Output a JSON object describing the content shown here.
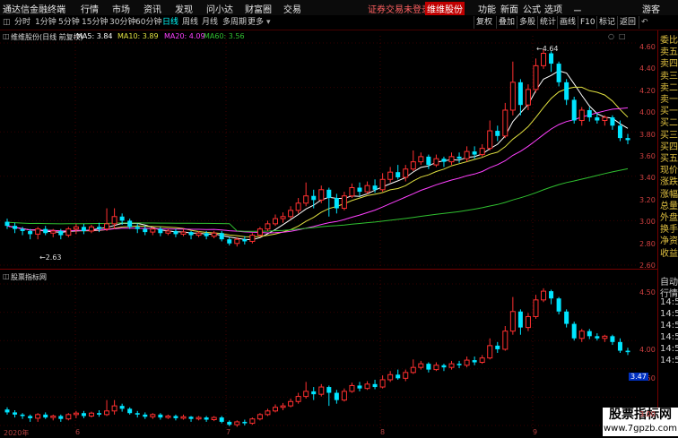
{
  "topbar": {
    "logo": "通达信金融终端",
    "menus": [
      "行情",
      "市场",
      "资讯",
      "发现",
      "问小达",
      "财富圈",
      "交易"
    ],
    "login_status": "证券交易未登录",
    "stock_name_red": "维维股份",
    "right_menus": [
      "功能",
      "新面",
      "公式",
      "选项"
    ],
    "user": "游客"
  },
  "toolbar": {
    "periods": [
      "分时",
      "1分钟",
      "5分钟",
      "15分钟",
      "30分钟",
      "60分钟",
      "日线",
      "周线",
      "月线",
      "多周期",
      "更多"
    ],
    "active_period": "日线",
    "right_buttons": [
      "复权",
      "叠加",
      "多股",
      "统计",
      "画线",
      "F10",
      "标记",
      "返回"
    ]
  },
  "indicator_line": {
    "title": "维维股份(日线 前复权)",
    "ma5": "MA5: 3.84",
    "ma10": "MA10: 3.89",
    "ma20": "MA20: 4.09",
    "ma60": "MA60: 3.56"
  },
  "main_yaxis": [
    "4.60",
    "4.40",
    "4.20",
    "4.00",
    "3.80",
    "3.60",
    "3.40",
    "3.20",
    "3.00",
    "2.80",
    "2.60"
  ],
  "annotations": {
    "high": "4.64",
    "low": "2.63"
  },
  "sub_panel": {
    "title": "股票指标网",
    "yaxis": [
      "4.50",
      "4.00",
      "3.50",
      "3.00"
    ],
    "current": "3.47"
  },
  "xaxis": [
    "2020年",
    "6",
    "7",
    "8",
    "9"
  ],
  "right_panel": {
    "rows": [
      "委比",
      "卖五",
      "卖四",
      "卖三",
      "卖二",
      "卖一",
      "买一",
      "买二",
      "买三",
      "买四",
      "买五",
      "现价",
      "涨跌",
      "涨幅",
      "总量",
      "外盘",
      "换手",
      "净资",
      "收益"
    ],
    "bottom_rows": [
      "自动",
      "行情",
      "14:50",
      "14:50",
      "14:50",
      "14:50",
      "14:50",
      "14:5"
    ]
  },
  "watermark": {
    "line1": "股票指标网",
    "line2": "www.7gpzb.com"
  },
  "colors": {
    "up": "#ff3030",
    "up_hollow": "#ff3030",
    "down": "#00e5ff",
    "ma5": "#ffffff",
    "ma10": "#e0e040",
    "ma20": "#ff40ff",
    "ma60": "#30c030"
  },
  "chart_data": {
    "type": "candlestick",
    "title": "维维股份(日线 前复权)",
    "ylim": [
      2.55,
      4.7
    ],
    "candles": [
      [
        2.97,
        2.93,
        3.0,
        2.9
      ],
      [
        2.93,
        2.9,
        2.96,
        2.86
      ],
      [
        2.9,
        2.88,
        2.92,
        2.84
      ],
      [
        2.88,
        2.85,
        2.9,
        2.8
      ],
      [
        2.85,
        2.9,
        2.92,
        2.8
      ],
      [
        2.9,
        2.86,
        2.93,
        2.84
      ],
      [
        2.86,
        2.88,
        2.9,
        2.82
      ],
      [
        2.88,
        2.84,
        2.9,
        2.8
      ],
      [
        2.84,
        2.9,
        2.92,
        2.82
      ],
      [
        2.9,
        2.92,
        2.95,
        2.85
      ],
      [
        2.92,
        2.88,
        2.95,
        2.85
      ],
      [
        2.88,
        2.92,
        2.94,
        2.86
      ],
      [
        2.92,
        2.9,
        2.96,
        2.87
      ],
      [
        2.9,
        2.95,
        3.1,
        2.88
      ],
      [
        2.95,
        3.02,
        3.1,
        2.9
      ],
      [
        3.02,
        2.98,
        3.05,
        2.94
      ],
      [
        2.98,
        2.92,
        3.0,
        2.9
      ],
      [
        2.92,
        2.9,
        2.95,
        2.86
      ],
      [
        2.9,
        2.87,
        2.93,
        2.84
      ],
      [
        2.87,
        2.9,
        2.92,
        2.84
      ],
      [
        2.9,
        2.86,
        2.92,
        2.83
      ],
      [
        2.86,
        2.88,
        2.9,
        2.84
      ],
      [
        2.88,
        2.85,
        2.9,
        2.82
      ],
      [
        2.85,
        2.87,
        2.9,
        2.83
      ],
      [
        2.87,
        2.84,
        2.88,
        2.8
      ],
      [
        2.84,
        2.86,
        2.88,
        2.82
      ],
      [
        2.86,
        2.83,
        2.88,
        2.8
      ],
      [
        2.83,
        2.86,
        2.88,
        2.81
      ],
      [
        2.86,
        2.8,
        2.88,
        2.78
      ],
      [
        2.8,
        2.76,
        2.82,
        2.74
      ],
      [
        2.76,
        2.8,
        2.82,
        2.73
      ],
      [
        2.8,
        2.78,
        2.83,
        2.75
      ],
      [
        2.78,
        2.84,
        2.86,
        2.76
      ],
      [
        2.84,
        2.9,
        2.92,
        2.82
      ],
      [
        2.9,
        2.95,
        2.98,
        2.88
      ],
      [
        2.95,
        3.0,
        3.04,
        2.93
      ],
      [
        3.0,
        3.02,
        3.06,
        2.96
      ],
      [
        3.02,
        3.08,
        3.12,
        3.0
      ],
      [
        3.08,
        3.15,
        3.2,
        3.05
      ],
      [
        3.15,
        3.22,
        3.35,
        3.12
      ],
      [
        3.22,
        3.18,
        3.28,
        3.1
      ],
      [
        3.18,
        3.28,
        3.32,
        3.15
      ],
      [
        3.28,
        3.2,
        3.3,
        3.02
      ],
      [
        3.2,
        3.1,
        3.24,
        3.05
      ],
      [
        3.1,
        3.22,
        3.26,
        3.08
      ],
      [
        3.22,
        3.3,
        3.34,
        3.2
      ],
      [
        3.3,
        3.26,
        3.35,
        3.22
      ],
      [
        3.26,
        3.32,
        3.36,
        3.24
      ],
      [
        3.32,
        3.28,
        3.38,
        3.25
      ],
      [
        3.28,
        3.38,
        3.44,
        3.26
      ],
      [
        3.38,
        3.45,
        3.5,
        3.35
      ],
      [
        3.45,
        3.4,
        3.52,
        3.38
      ],
      [
        3.4,
        3.48,
        3.52,
        3.36
      ],
      [
        3.48,
        3.55,
        3.66,
        3.46
      ],
      [
        3.55,
        3.6,
        3.64,
        3.52
      ],
      [
        3.6,
        3.52,
        3.62,
        3.48
      ],
      [
        3.52,
        3.58,
        3.62,
        3.5
      ],
      [
        3.58,
        3.55,
        3.6,
        3.5
      ],
      [
        3.55,
        3.6,
        3.64,
        3.52
      ],
      [
        3.6,
        3.58,
        3.64,
        3.54
      ],
      [
        3.58,
        3.65,
        3.7,
        3.55
      ],
      [
        3.65,
        3.62,
        3.7,
        3.58
      ],
      [
        3.62,
        3.68,
        3.72,
        3.6
      ],
      [
        3.68,
        3.85,
        3.95,
        3.66
      ],
      [
        3.85,
        3.8,
        3.9,
        3.75
      ],
      [
        3.8,
        4.05,
        4.12,
        3.78
      ],
      [
        4.05,
        4.32,
        4.52,
        4.0
      ],
      [
        4.32,
        4.1,
        4.35,
        4.0
      ],
      [
        4.1,
        4.25,
        4.3,
        4.05
      ],
      [
        4.25,
        4.48,
        4.55,
        4.22
      ],
      [
        4.48,
        4.6,
        4.64,
        4.45
      ],
      [
        4.6,
        4.5,
        4.62,
        4.42
      ],
      [
        4.5,
        4.32,
        4.52,
        4.28
      ],
      [
        4.32,
        4.15,
        4.35,
        4.1
      ],
      [
        4.15,
        3.95,
        4.18,
        3.92
      ],
      [
        3.95,
        4.05,
        4.08,
        3.9
      ],
      [
        4.05,
        3.98,
        4.08,
        3.94
      ],
      [
        3.98,
        3.95,
        4.02,
        3.92
      ],
      [
        3.95,
        3.98,
        4.0,
        3.9
      ],
      [
        3.98,
        3.9,
        4.0,
        3.86
      ],
      [
        3.9,
        3.78,
        3.95,
        3.75
      ],
      [
        3.78,
        3.76,
        3.82,
        3.72
      ]
    ],
    "sub_series_ylim": [
      2.75,
      4.7
    ]
  }
}
